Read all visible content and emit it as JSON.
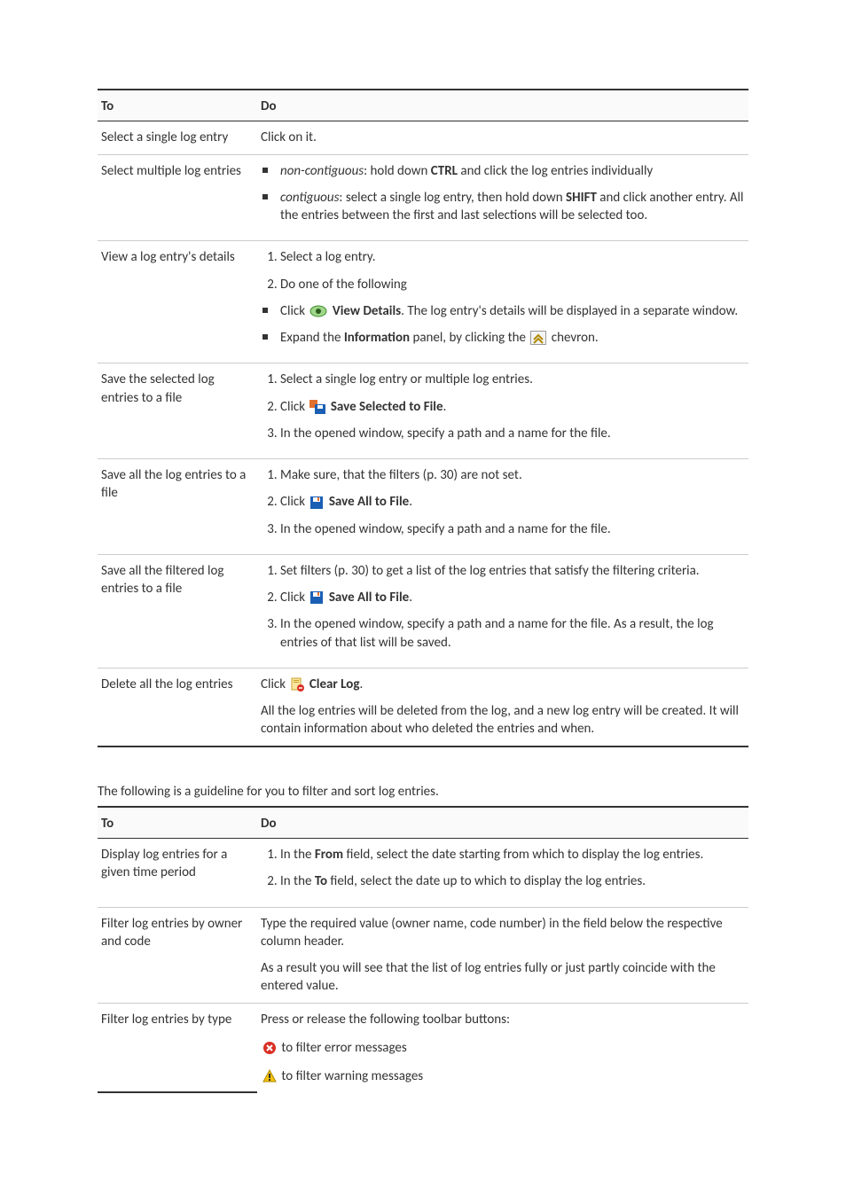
{
  "headers": {
    "to": "To",
    "do": "Do"
  },
  "t1": {
    "r0": {
      "to": "Select a single log entry",
      "do": "Click on it."
    },
    "r1": {
      "to": "Select multiple log entries",
      "li0_a": "non-contiguous",
      "li0_b": ": hold down ",
      "li0_c": "CTRL",
      "li0_d": " and click the log entries individually",
      "li1_a": "contiguous",
      "li1_b": ": select a single log entry, then hold down ",
      "li1_c": "SHIFT",
      "li1_d": " and click another entry. All the entries between the first and last selections will be selected too."
    },
    "r2": {
      "to": "View a log entry's details",
      "li0": "Select a log entry.",
      "li1": "Do one of the following",
      "li2_a": "Click ",
      "li2_b": "View Details",
      "li2_c": ". The log entry's details will be displayed in a separate window.",
      "li3_a": "Expand the ",
      "li3_b": "Information",
      "li3_c": " panel, by clicking the ",
      "li3_d": " chevron."
    },
    "r3": {
      "to": "Save the selected log entries to a file",
      "li0": "Select a single log entry or multiple log entries.",
      "li1_a": "Click ",
      "li1_b": "Save Selected to File",
      "li1_c": ".",
      "li2": "In the opened window, specify a path and a name for the file."
    },
    "r4": {
      "to": "Save all the log entries to a file",
      "li0": "Make sure, that the filters (p. 30) are not set.",
      "li1_a": "Click ",
      "li1_b": "Save All to File",
      "li1_c": ".",
      "li2": "In the opened window, specify a path and a name for the file."
    },
    "r5": {
      "to": "Save all the filtered log entries to a file",
      "li0": "Set filters (p. 30) to get a list of the log entries that satisfy the filtering criteria.",
      "li1_a": "Click ",
      "li1_b": "Save All to File",
      "li1_c": ".",
      "li2": "In the opened window, specify a path and a name for the file. As a result, the log entries of that list will be saved."
    },
    "r6": {
      "to": "Delete all the log entries",
      "p0_a": "Click ",
      "p0_b": "Clear Log",
      "p0_c": ".",
      "p1": "All the log entries will be deleted from the log, and a new log entry will be created. It will contain information about who deleted the entries and when."
    }
  },
  "caption2": "The following is a guideline for you to filter and sort log entries.",
  "t2": {
    "r0": {
      "to": "Display log entries for a given time period",
      "li0_a": "In the ",
      "li0_b": "From",
      "li0_c": " field, select the date starting from which to display the log entries.",
      "li1_a": "In the ",
      "li1_b": "To",
      "li1_c": " field, select the date up to which to display the log entries."
    },
    "r1": {
      "to": "Filter log entries by owner and code",
      "p0": "Type the required value (owner name, code number) in the field below the respective column header.",
      "p1": "As a result you will see that the list of log entries fully or just partly coincide with the entered value."
    },
    "r2": {
      "to": "Filter log entries by type",
      "p0": "Press or release the following toolbar buttons:",
      "li0": " to filter error messages",
      "li1": " to filter warning messages"
    }
  }
}
